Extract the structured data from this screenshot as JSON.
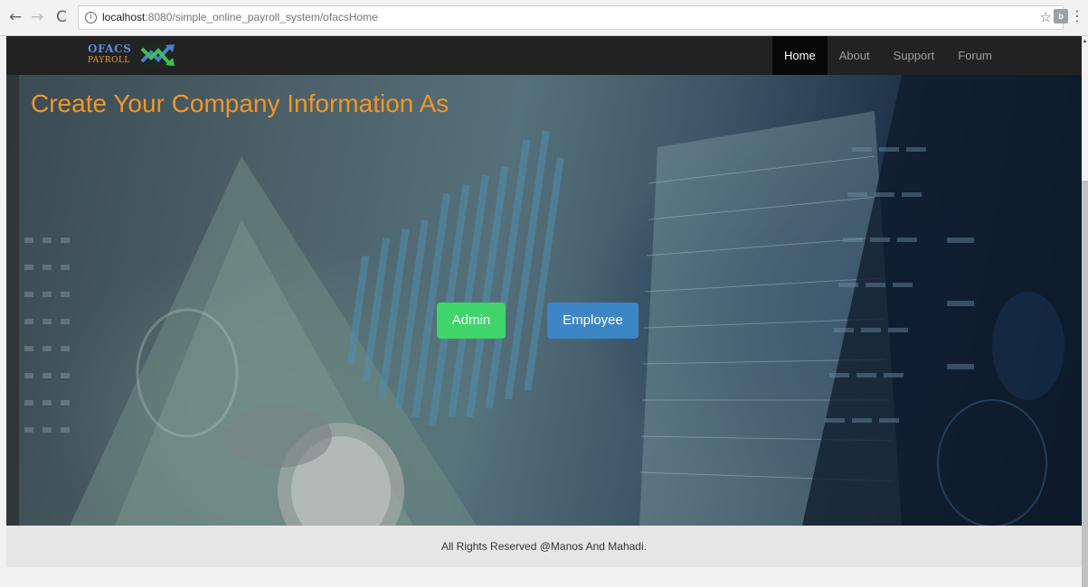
{
  "browser": {
    "url_host": "localhost",
    "url_path": ":8080/simple_online_payroll_system/ofacsHome",
    "info_symbol": "i",
    "back_symbol": "←",
    "forward_symbol": "→",
    "reload_symbol": "C",
    "star_symbol": "☆",
    "extension_label": "b",
    "menu_symbol": "⋮"
  },
  "navbar": {
    "brand_top": "OFACS",
    "brand_bottom": "PAYROLL",
    "links": [
      {
        "label": "Home",
        "active": true
      },
      {
        "label": "About",
        "active": false
      },
      {
        "label": "Support",
        "active": false
      },
      {
        "label": "Forum",
        "active": false
      }
    ]
  },
  "hero": {
    "title": "Create Your Company Information As",
    "admin_label": "Admin",
    "employee_label": "Employee"
  },
  "footer": {
    "text": "All Rights Reserved @Manos And Mahadi."
  },
  "colors": {
    "title": "#f0962a",
    "admin_button": "#3fd56b",
    "employee_button": "#3d86c6",
    "navbar": "#222222",
    "footer": "#e6e6e6"
  }
}
